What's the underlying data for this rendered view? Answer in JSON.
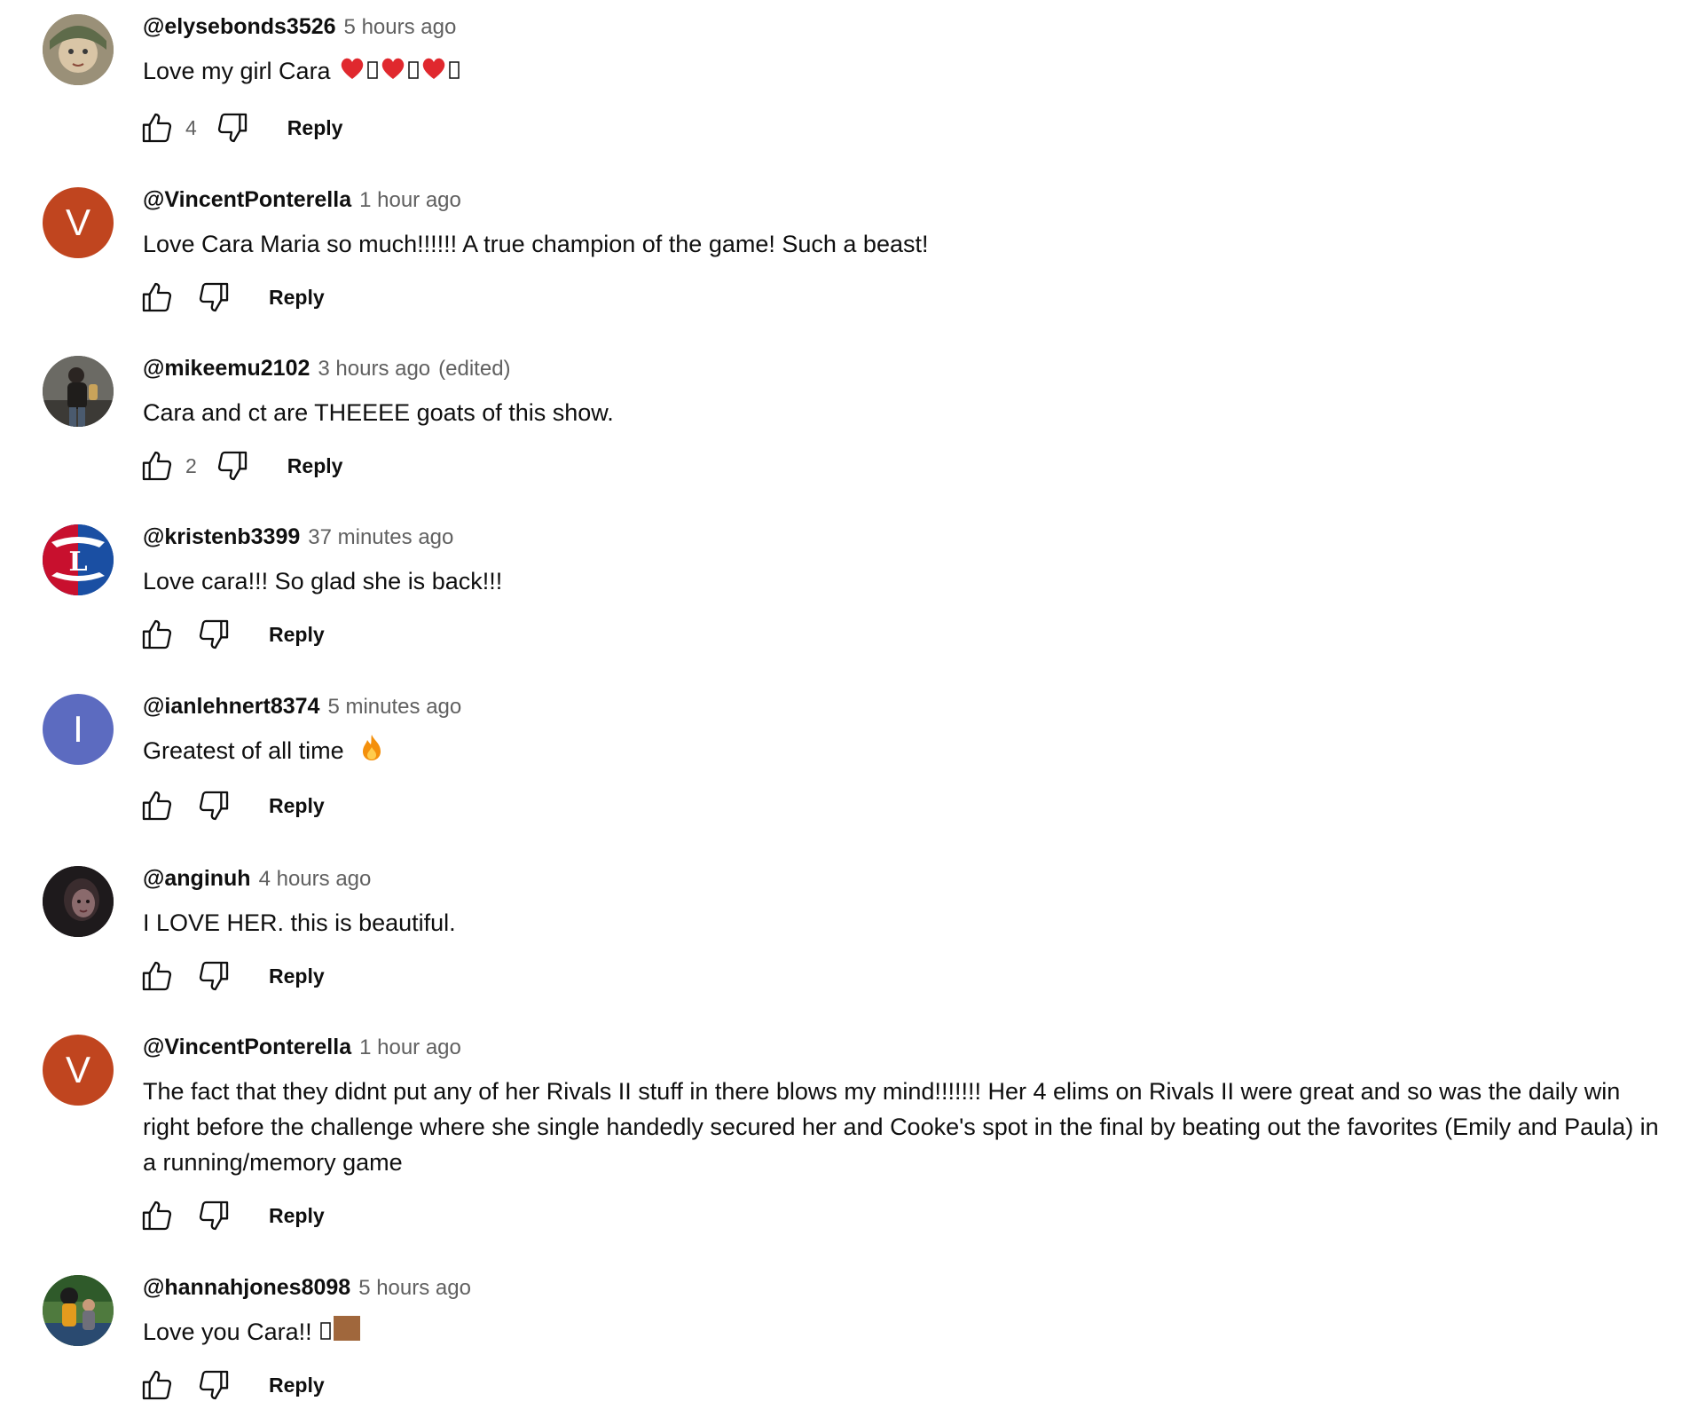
{
  "reply_label": "Reply",
  "comments": [
    {
      "author": "@elysebonds3526",
      "time": "5 hours ago",
      "edited": "",
      "text": "Love my girl Cara",
      "likes": "4",
      "avatar_type": "photo",
      "avatar_color": "#8a7f68"
    },
    {
      "author": "@VincentPonterella",
      "time": "1 hour ago",
      "edited": "",
      "text": "Love Cara Maria so much!!!!!! A true champion of the game! Such a beast!",
      "likes": "",
      "avatar_type": "initial",
      "avatar_initial": "V",
      "avatar_color": "#c0451f"
    },
    {
      "author": "@mikeemu2102",
      "time": "3 hours ago",
      "edited": "(edited)",
      "text": "Cara and ct are THEEEE goats of this show.",
      "likes": "2",
      "avatar_type": "photo",
      "avatar_color": "#4e4a44"
    },
    {
      "author": "@kristenb3399",
      "time": "37 minutes ago",
      "edited": "",
      "text": "Love cara!!! So glad she is back!!!",
      "likes": "",
      "avatar_type": "logo",
      "avatar_color": "#1a4fa3"
    },
    {
      "author": "@ianlehnert8374",
      "time": "5 minutes ago",
      "edited": "",
      "text": "Greatest of all time",
      "likes": "",
      "avatar_type": "initial",
      "avatar_initial": "I",
      "avatar_color": "#5c6bc0"
    },
    {
      "author": "@anginuh",
      "time": "4 hours ago",
      "edited": "",
      "text": "I LOVE HER. this is beautiful.",
      "likes": "",
      "avatar_type": "photo",
      "avatar_color": "#2a2224"
    },
    {
      "author": "@VincentPonterella",
      "time": "1 hour ago",
      "edited": "",
      "text": "The fact that they didnt put any of her Rivals II stuff in there blows my mind!!!!!!! Her 4 elims on Rivals II were great and so was the daily win right before the challenge where she single handedly secured her and Cooke's spot in the final by beating out the favorites (Emily and Paula) in a running/memory game",
      "likes": "",
      "avatar_type": "initial",
      "avatar_initial": "V",
      "avatar_color": "#c0451f"
    },
    {
      "author": "@hannahjones8098",
      "time": "5 hours ago",
      "edited": "",
      "text": "Love you Cara!!",
      "likes": "",
      "avatar_type": "photo",
      "avatar_color": "#3f6b3a"
    }
  ]
}
